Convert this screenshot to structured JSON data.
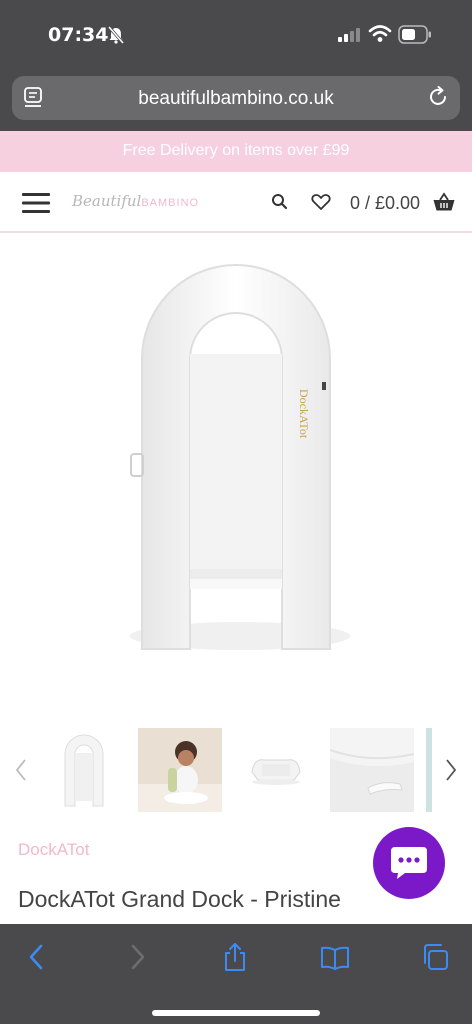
{
  "status_bar": {
    "time": "07:34"
  },
  "browser": {
    "url": "beautifulbambino.co.uk"
  },
  "promo": {
    "text": "Free Delivery on items over £99"
  },
  "header": {
    "logo_script": "Beautiful",
    "logo_caps": "BAMBINO",
    "cart_total": "0 / £0.00"
  },
  "product": {
    "brand": "DockATot",
    "title": "DockATot Grand Dock - Pristine",
    "image_print": "DockATot",
    "thumbnails": [
      "product-front",
      "baby-in-dock",
      "dock-side",
      "fabric-detail",
      "more"
    ]
  },
  "colors": {
    "chrome": "#4a4a4c",
    "promo_bg": "#f6d0df",
    "brand_pink": "#f2b8cc",
    "chat_purple": "#7b19c8",
    "ios_blue": "#3d8bf2"
  }
}
